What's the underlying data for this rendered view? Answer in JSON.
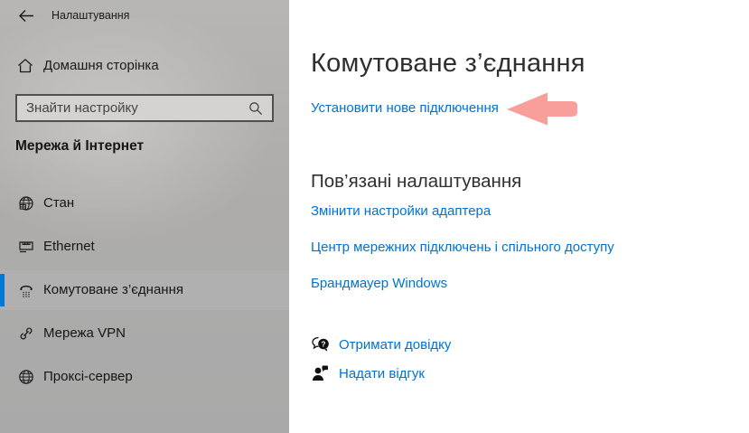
{
  "window": {
    "title": "Налаштування"
  },
  "sidebar": {
    "home_label": "Домашня сторінка",
    "search_placeholder": "Знайти настройку",
    "section_title": "Мережа й Інтернет",
    "items": [
      {
        "label": "Стан",
        "icon": "network-status-icon",
        "selected": false
      },
      {
        "label": "Ethernet",
        "icon": "ethernet-icon",
        "selected": false
      },
      {
        "label": "Комутоване з’єднання",
        "icon": "dialup-phone-icon",
        "selected": true
      },
      {
        "label": "Мережа VPN",
        "icon": "vpn-icon",
        "selected": false
      },
      {
        "label": "Проксі-сервер",
        "icon": "proxy-globe-icon",
        "selected": false
      }
    ]
  },
  "main": {
    "title": "Комутоване з’єднання",
    "primary_link": "Установити нове підключення",
    "related": {
      "heading": "Пов’язані налаштування",
      "links": [
        "Змінити настройки адаптера",
        "Центр мережних підключень і спільного доступу",
        "Брандмауер Windows"
      ]
    },
    "help_links": [
      {
        "label": "Отримати довідку",
        "icon": "help-bubble-icon"
      },
      {
        "label": "Надати відгук",
        "icon": "feedback-person-icon"
      }
    ]
  },
  "colors": {
    "accent": "#0078d7",
    "link_blue": "#0072d4",
    "annotation_arrow": "#f89e9b",
    "sidebar_gray": "#adacaa"
  }
}
